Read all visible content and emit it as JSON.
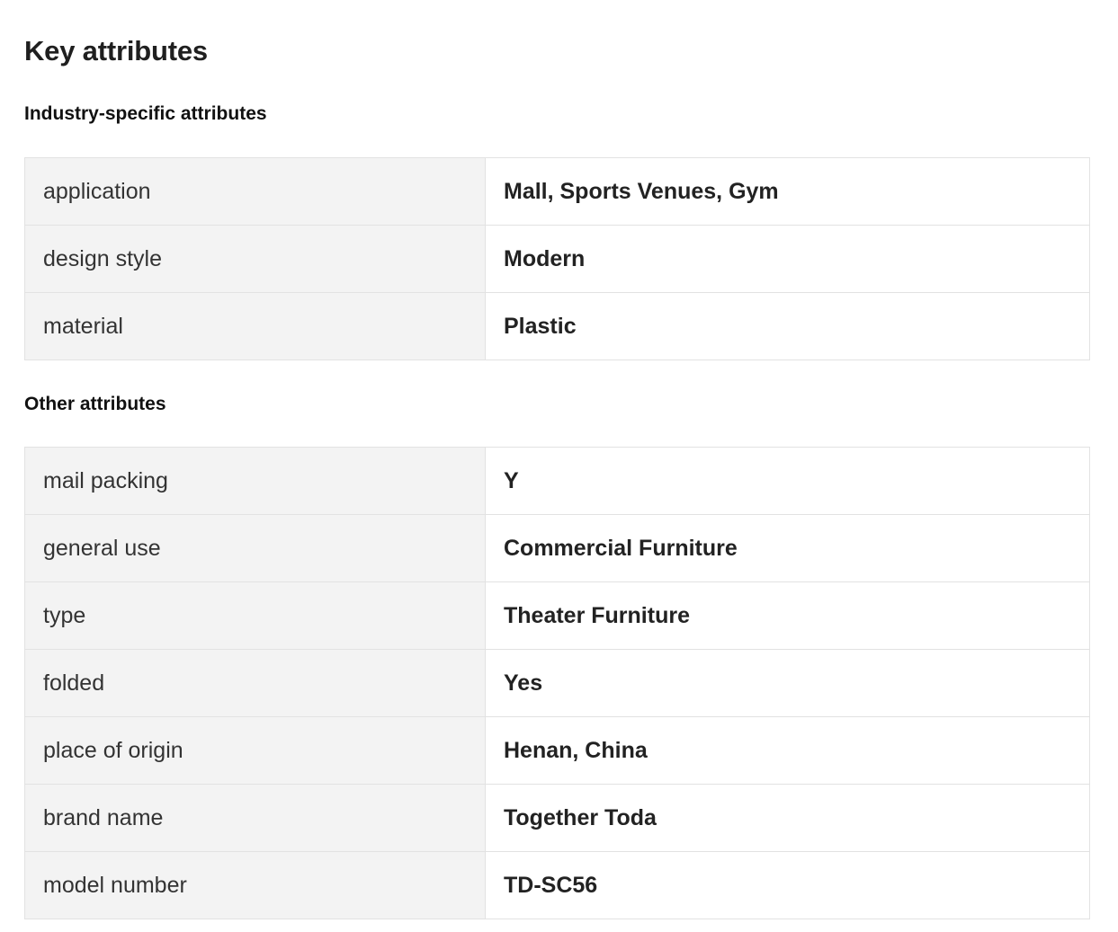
{
  "title": "Key attributes",
  "sections": [
    {
      "heading": "Industry-specific attributes",
      "rows": [
        {
          "key": "application",
          "value": "Mall, Sports Venues, Gym"
        },
        {
          "key": "design style",
          "value": "Modern"
        },
        {
          "key": "material",
          "value": "Plastic"
        }
      ]
    },
    {
      "heading": "Other attributes",
      "rows": [
        {
          "key": "mail packing",
          "value": "Y"
        },
        {
          "key": "general use",
          "value": "Commercial Furniture"
        },
        {
          "key": "type",
          "value": "Theater Furniture"
        },
        {
          "key": "folded",
          "value": "Yes"
        },
        {
          "key": "place of origin",
          "value": "Henan, China"
        },
        {
          "key": "brand name",
          "value": "Together Toda"
        },
        {
          "key": "model number",
          "value": "TD-SC56"
        }
      ]
    }
  ]
}
